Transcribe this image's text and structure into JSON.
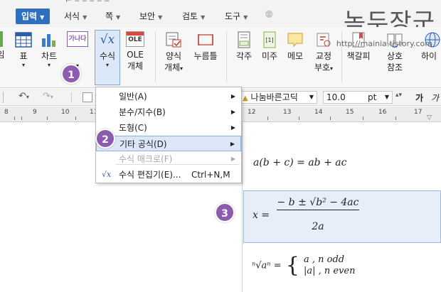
{
  "menubar": {
    "items": [
      {
        "label": "입력",
        "active": true
      },
      {
        "label": "서식"
      },
      {
        "label": "쪽"
      },
      {
        "label": "보안"
      },
      {
        "label": "검토"
      },
      {
        "label": "도구"
      }
    ]
  },
  "logo": {
    "text": "녹두장군",
    "url": "http://mainia.tistory.com"
  },
  "ribbon": {
    "buttons": [
      {
        "label": "표"
      },
      {
        "label": "차트"
      },
      {
        "label": "수식"
      },
      {
        "label": "OLE",
        "label2": "개체"
      },
      {
        "label": "양식",
        "label2": "개체"
      },
      {
        "label": "누름틀"
      },
      {
        "label": "각주"
      },
      {
        "label": "미주"
      },
      {
        "label": "메모"
      },
      {
        "label": "교정",
        "label2": "부호"
      },
      {
        "label": "책갈피"
      },
      {
        "label": "상호",
        "label2": "참조"
      },
      {
        "label": "하이"
      }
    ],
    "icon_text": {
      "chart_hangul": "가나다",
      "ole": "OLE",
      "formula": "√x"
    }
  },
  "fmtbar": {
    "font_name": "나눔바른고딕",
    "font_size": "10.0",
    "unit": "pt",
    "bold_glyph": "가",
    "italic_glyph": "가"
  },
  "ruler": {
    "numbers": [
      "8",
      "9",
      "10",
      "11",
      "12",
      "13",
      "14",
      "15",
      "16",
      "17"
    ]
  },
  "dropdown": {
    "items": [
      {
        "label": "일반(A)"
      },
      {
        "label": "분수/지수(B)"
      },
      {
        "label": "도형(C)"
      },
      {
        "label": "기타 공식(D)"
      },
      {
        "label": "수식 매크로(F)"
      },
      {
        "label": "수식 편집기(E)...",
        "shortcut": "Ctrl+N,M"
      }
    ]
  },
  "badges": [
    "1",
    "2",
    "3"
  ],
  "equations": {
    "eq1": "a(b + c) = ab + ac",
    "eq2_lhs": "x =",
    "eq2_num": "− b ± √b² − 4ac",
    "eq2_den": "2a",
    "eq3_lhs": "ⁿ√aⁿ =",
    "eq3_case1": "a , n odd",
    "eq3_case2": "|a| , n even"
  }
}
